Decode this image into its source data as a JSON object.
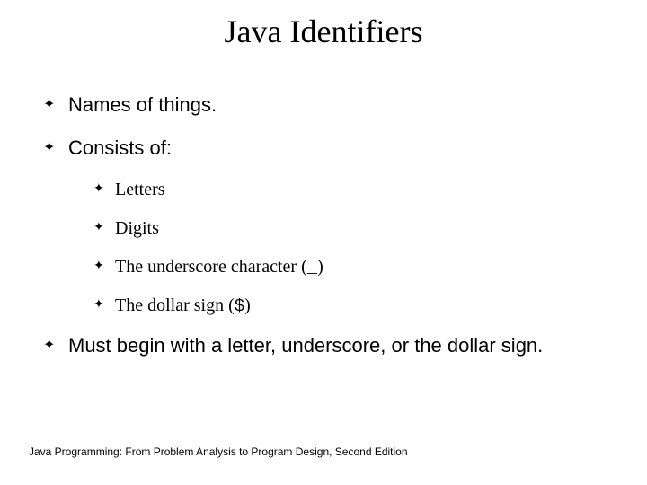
{
  "title": "Java Identifiers",
  "bullets": {
    "b1": "Names of things.",
    "b2": "Consists of:",
    "b2_sub": {
      "s1": "Letters",
      "s2": "Digits",
      "s3_pre": "The underscore character (",
      "s3_mono": "_",
      "s3_post": ")",
      "s4_pre": "The dollar sign (",
      "s4_mono": "$",
      "s4_post": ")"
    },
    "b3": "Must begin with a letter, underscore, or the dollar sign."
  },
  "footer": "Java Programming: From Problem Analysis to Program Design, Second Edition",
  "marker": "✦"
}
